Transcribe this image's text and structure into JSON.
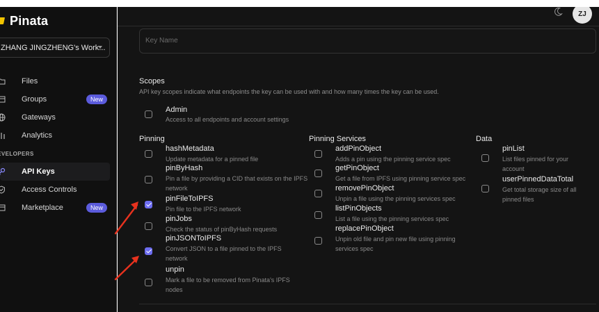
{
  "app": {
    "logo_text": "Pinata",
    "workspace_label": "ZHANG JINGZHENG's Work..."
  },
  "sidebar": {
    "items": [
      {
        "label": "Files",
        "icon": "folder-icon"
      },
      {
        "label": "Groups",
        "icon": "box-icon",
        "badge": "New"
      },
      {
        "label": "Gateways",
        "icon": "globe-icon"
      },
      {
        "label": "Analytics",
        "icon": "bar-chart-icon"
      }
    ],
    "section": "DEVELOPERS",
    "dev_items": [
      {
        "label": "API Keys",
        "icon": "key-icon",
        "active": true
      },
      {
        "label": "Access Controls",
        "icon": "shield-icon"
      },
      {
        "label": "Marketplace",
        "icon": "store-icon",
        "badge": "New"
      }
    ]
  },
  "header": {
    "avatar_initials": "ZJ"
  },
  "form": {
    "key_name_placeholder": "Key Name",
    "scopes_title": "Scopes",
    "scopes_desc": "API key scopes indicate what endpoints the key can be used with and how many times the key can be used.",
    "admin": {
      "title": "Admin",
      "desc": "Access to all endpoints and account settings",
      "checked": false
    }
  },
  "pinning": {
    "title": "Pinning",
    "items": [
      {
        "title": "hashMetadata",
        "desc": "Update metadata for a pinned file",
        "checked": false
      },
      {
        "title": "pinByHash",
        "desc": "Pin a file by providing a CID that exists on the IPFS network",
        "checked": false
      },
      {
        "title": "pinFileToIPFS",
        "desc": "Pin file to the IPFS network",
        "checked": true
      },
      {
        "title": "pinJobs",
        "desc": "Check the status of pinByHash requests",
        "checked": false
      },
      {
        "title": "pinJSONToIPFS",
        "desc": "Convert JSON to a file pinned to the IPFS network",
        "checked": true
      },
      {
        "title": "unpin",
        "desc": "Mark a file to be removed from Pinata's IPFS nodes",
        "checked": false
      }
    ]
  },
  "pinning_services": {
    "title": "Pinning Services",
    "items": [
      {
        "title": "addPinObject",
        "desc": "Adds a pin using the pinning service spec",
        "checked": false
      },
      {
        "title": "getPinObject",
        "desc": "Get a file from IPFS using pinning service spec",
        "checked": false
      },
      {
        "title": "removePinObject",
        "desc": "Unpin a file using the pinning services spec",
        "checked": false
      },
      {
        "title": "listPinObjects",
        "desc": "List a file using the pinning services spec",
        "checked": false
      },
      {
        "title": "replacePinObject",
        "desc": "Unpin old file and pin new file using pinning services spec",
        "checked": false
      }
    ]
  },
  "data_scopes": {
    "title": "Data",
    "items": [
      {
        "title": "pinList",
        "desc": "List files pinned for your account",
        "checked": false
      },
      {
        "title": "userPinnedDataTotal",
        "desc": "Get total storage size of all pinned files",
        "checked": false
      }
    ]
  },
  "colors": {
    "accent": "#6d6df0",
    "badge": "#5b5bdc",
    "arrow": "#e8321e",
    "logo": "#f2c400"
  }
}
